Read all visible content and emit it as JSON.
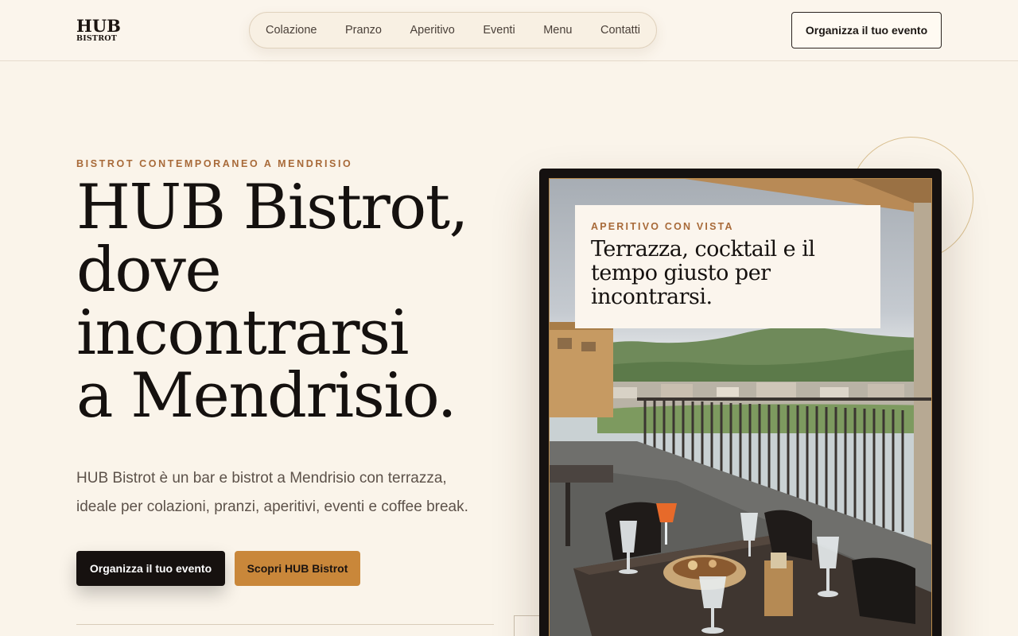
{
  "header": {
    "logo_top": "HUB",
    "logo_bottom": "BISTROT",
    "nav": [
      "Colazione",
      "Pranzo",
      "Aperitivo",
      "Eventi",
      "Menu",
      "Contatti"
    ],
    "cta": "Organizza il tuo evento"
  },
  "hero": {
    "eyebrow": "BISTROT CONTEMPORANEO A MENDRISIO",
    "headline_lines": [
      "HUB Bistrot,",
      "dove",
      "incontrarsi",
      "a Mendrisio."
    ],
    "lead_lines": [
      "HUB Bistrot è un bar e bistrot a Mendrisio con terrazza,",
      "ideale per colazioni, pranzi, aperitivi, eventi e coffee break."
    ],
    "primary_button": "Organizza il tuo evento",
    "secondary_button": "Scopri HUB Bistrot"
  },
  "feature_card": {
    "eyebrow": "APERITIVO CON VISTA",
    "title_lines": [
      "Terrazza, cocktail e il",
      "tempo giusto per",
      "incontrarsi."
    ],
    "image": "terrace-photo"
  }
}
